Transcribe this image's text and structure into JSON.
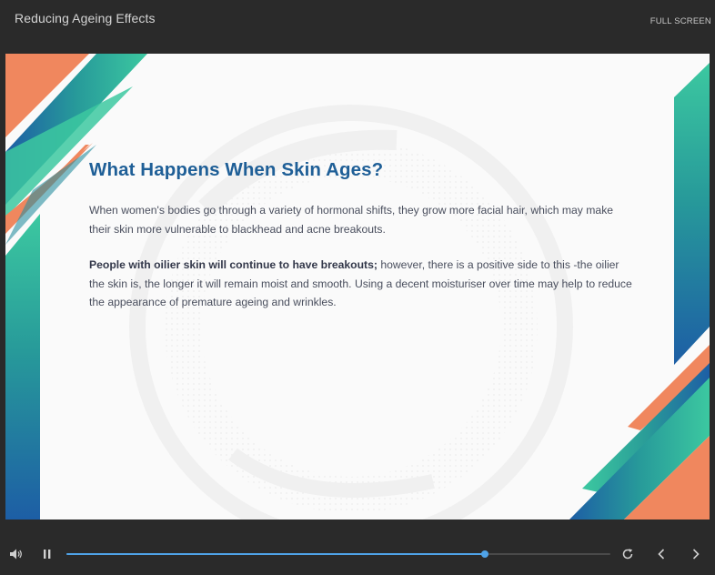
{
  "header": {
    "title": "Reducing Ageing Effects",
    "fullscreen_label": "FULL SCREEN"
  },
  "slide": {
    "heading": "What Happens When Skin Ages?",
    "paragraph1": "When women's bodies go through a variety of hormonal shifts, they grow more facial hair, which may make their skin more vulnerable to blackhead and acne breakouts.",
    "paragraph2_bold": "People with oilier skin will continue to have breakouts;",
    "paragraph2_rest": " however, there is a positive side to this -the oilier the skin is, the longer it will remain moist and smooth. Using a decent moisturiser over time may help to reduce the appearance of premature ageing and wrinkles.",
    "colors": {
      "heading": "#1f5f97",
      "orange": "#f0875e",
      "teal": "#3cc3a0",
      "blue": "#1d5ea5"
    }
  },
  "player": {
    "progress_fraction": 0.77,
    "accent_color": "#4fa3e8",
    "icons": [
      "volume-icon",
      "pause-icon",
      "replay-icon",
      "previous-icon",
      "next-icon"
    ]
  }
}
